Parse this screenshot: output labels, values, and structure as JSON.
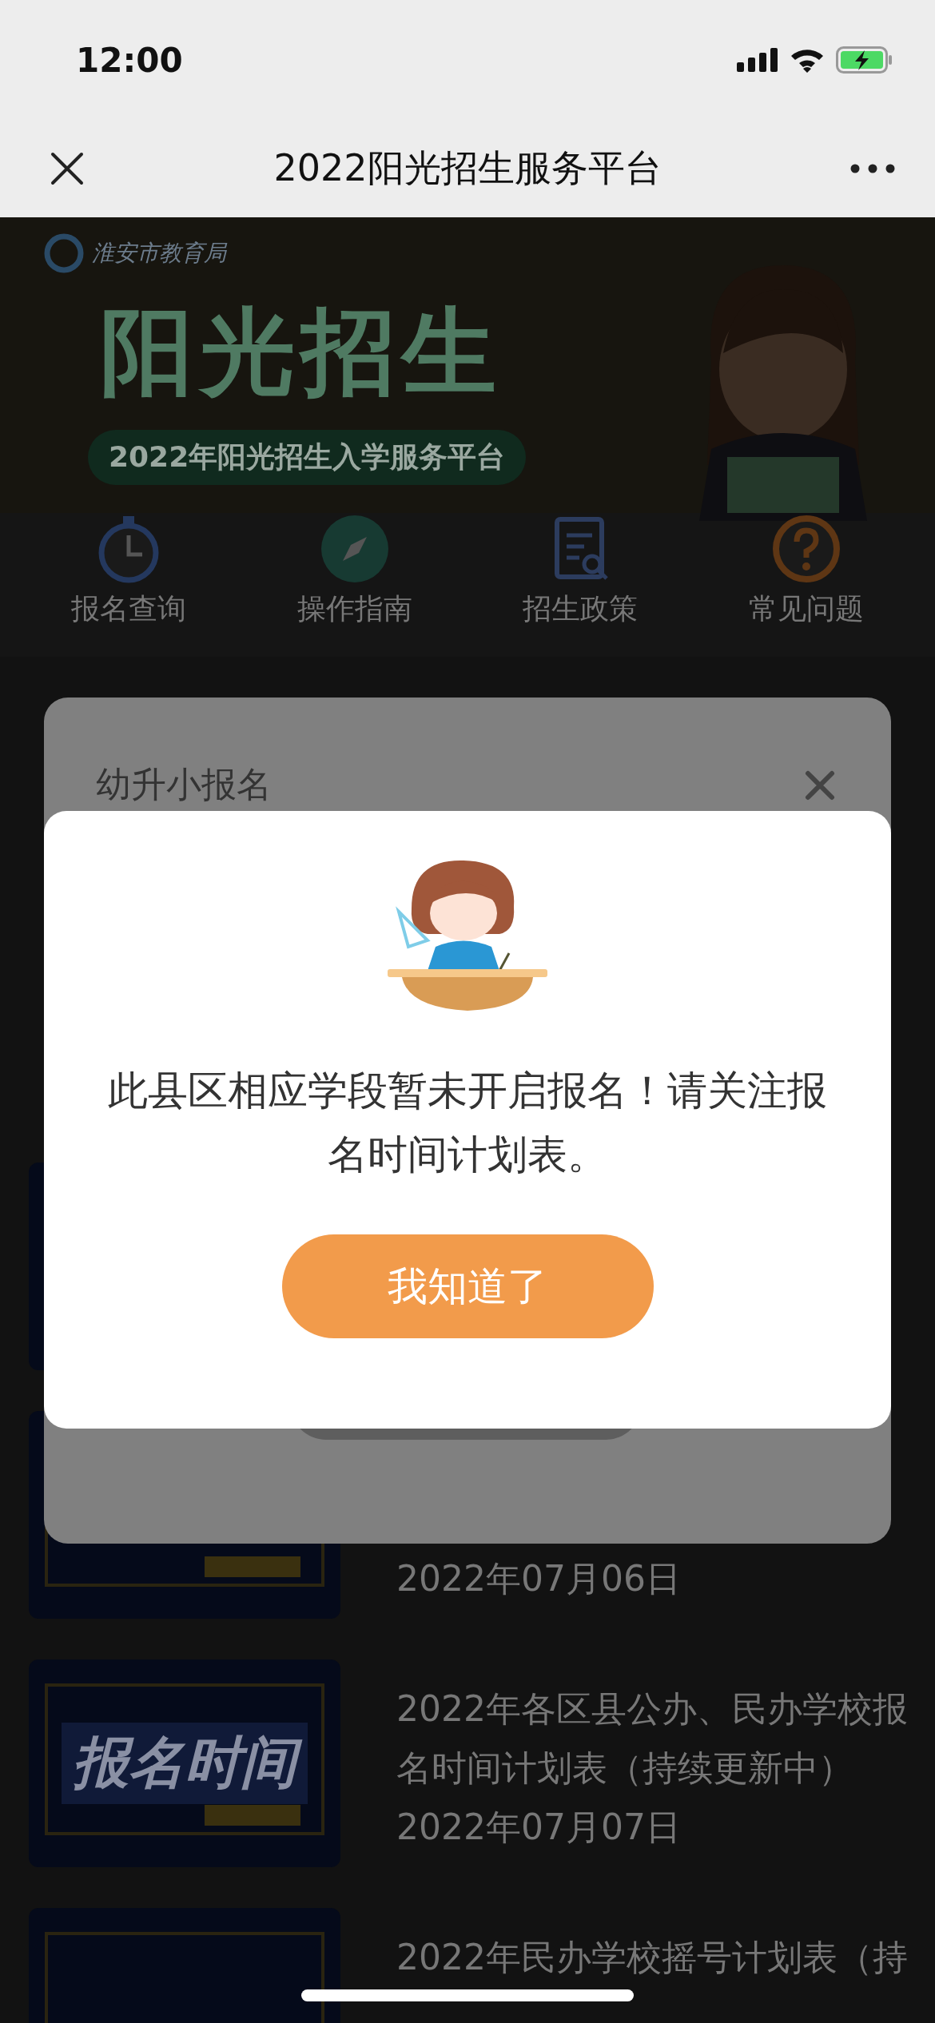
{
  "status_bar": {
    "time": "12:00"
  },
  "nav": {
    "title": "2022阳光招生服务平台"
  },
  "banner": {
    "org": "淮安市教育局",
    "headline": "阳光招生",
    "subtitle": "2022年阳光招生入学服务平台"
  },
  "shortcuts": [
    {
      "label": "报名查询",
      "kind": "timer"
    },
    {
      "label": "操作指南",
      "kind": "compass"
    },
    {
      "label": "招生政策",
      "kind": "document"
    },
    {
      "label": "常见问题",
      "kind": "question"
    }
  ],
  "articles": [
    {
      "date": "2022年07月06日"
    },
    {
      "thumb_text": "报名时间",
      "title": "2022年各区县公办、民办学校报名时间计划表（持续更新中）",
      "date": "2022年07月07日"
    },
    {
      "title": "2022年民办学校摇号计划表（持"
    }
  ],
  "modal": {
    "title": "幼升小报名"
  },
  "alert": {
    "message": "此县区相应学段暂未开启报名！请关注报名时间计划表。",
    "button": "我知道了"
  }
}
